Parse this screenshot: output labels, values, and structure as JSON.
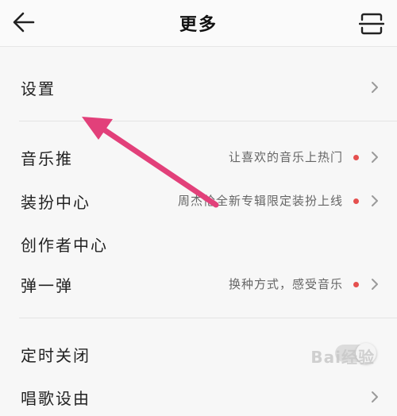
{
  "header": {
    "title": "更多",
    "back_icon": "back-arrow-icon",
    "scan_icon": "scan-icon"
  },
  "sections": {
    "settings": {
      "label": "设置"
    },
    "music_push": {
      "label": "音乐推",
      "sub": "让喜欢的音乐上热门",
      "has_dot": true
    },
    "dress_center": {
      "label": "装扮中心",
      "sub": "周杰伦全新专辑限定装扮上线",
      "has_dot": true
    },
    "creator_center": {
      "label": "创作者中心"
    },
    "bounce": {
      "label": "弹一弹",
      "sub": "换种方式，感受音乐",
      "has_dot": true
    },
    "timer_off": {
      "label": "定时关闭"
    },
    "ringtone": {
      "label": "唱歌设由"
    }
  },
  "colors": {
    "accent_dot": "#e5504f",
    "annotation_arrow": "#e2407a"
  },
  "watermark": "Bai经验"
}
